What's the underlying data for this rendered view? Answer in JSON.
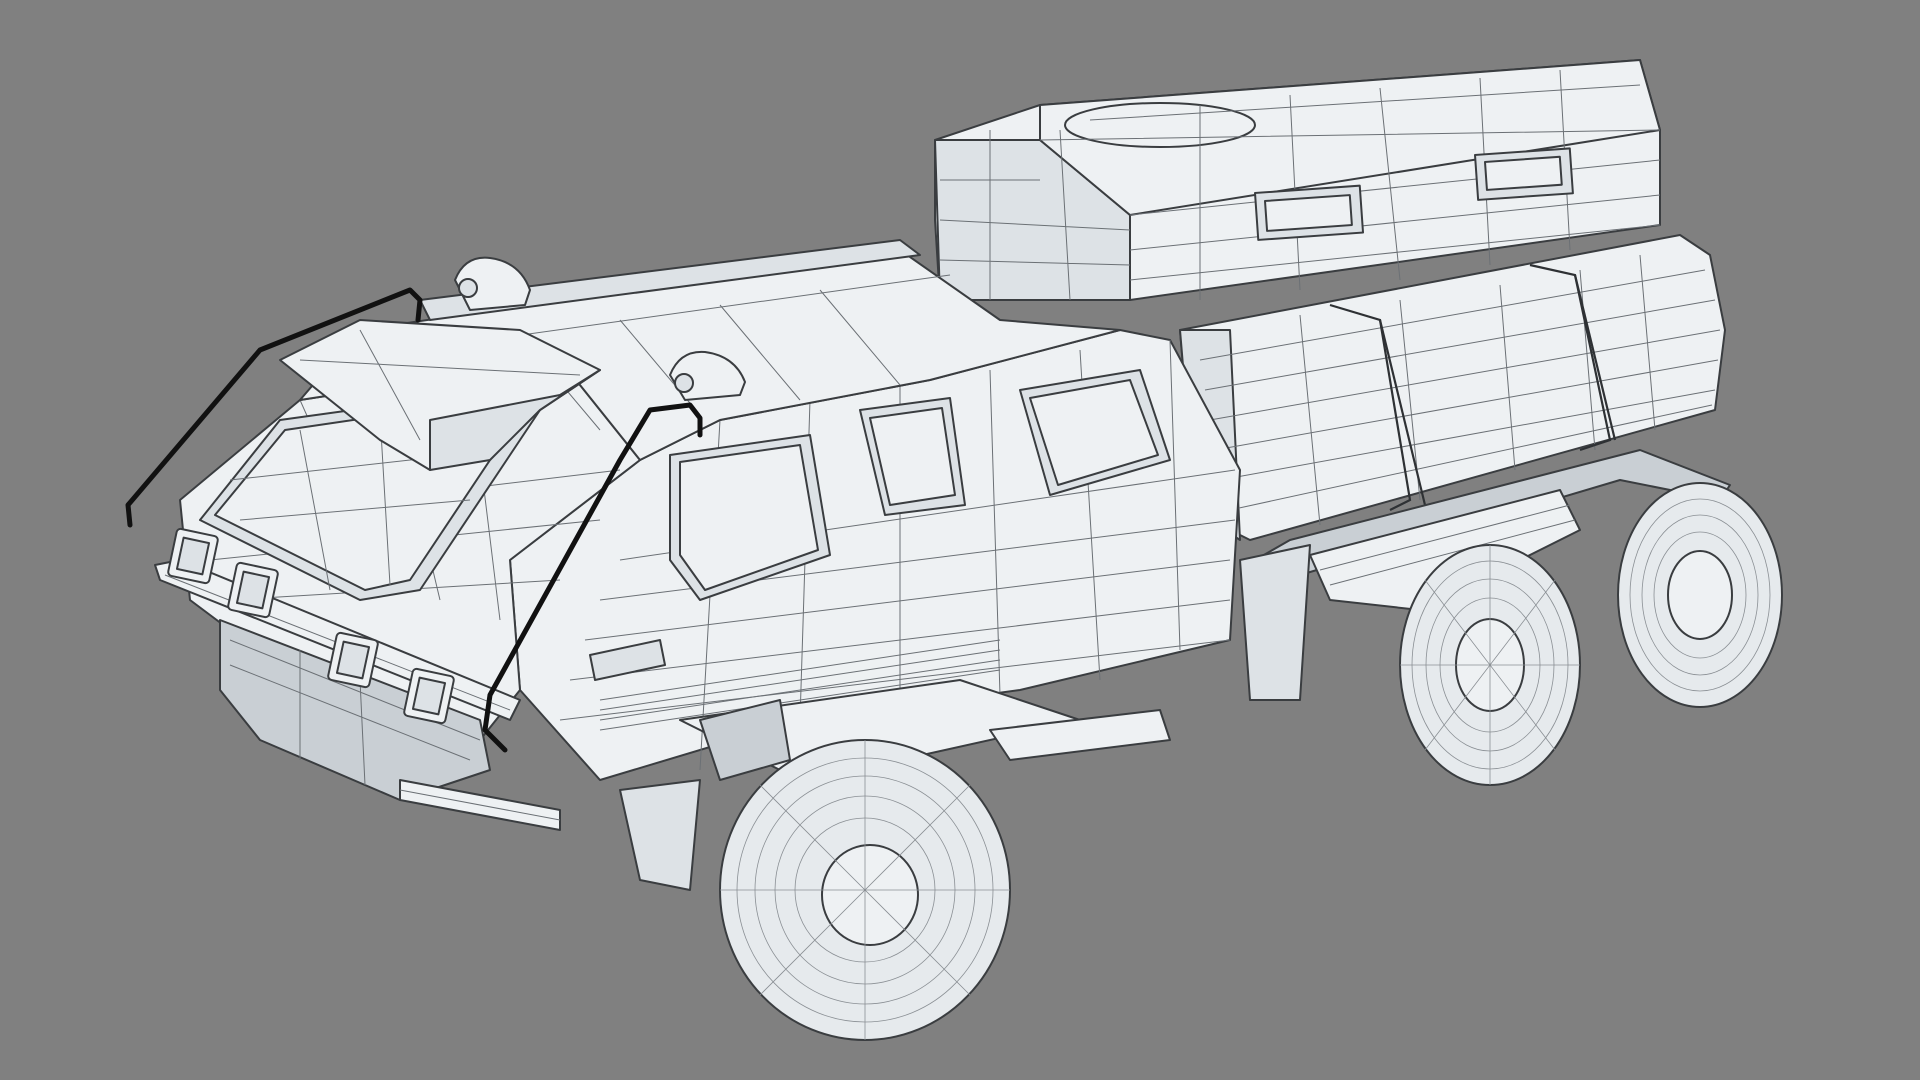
{
  "scene": {
    "background_color": "#808080",
    "model_color": "#eef1f3",
    "wire_color": "#6b7075",
    "rail_color": "#111111"
  }
}
